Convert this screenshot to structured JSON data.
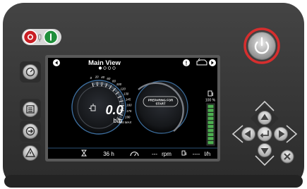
{
  "header": {
    "title": "Main View",
    "page_count": 4,
    "active_page": 0,
    "icons": [
      "left-arrow-icon",
      "info-icon",
      "engine-icon",
      "right-arrow-icon"
    ]
  },
  "pressure_gauge": {
    "value": "0.0",
    "unit": "bar",
    "scale_labels": [
      "0",
      "20",
      "40",
      "60",
      "80",
      "100",
      "120",
      "130",
      "145",
      "160",
      "175",
      "190",
      "205 MAX"
    ]
  },
  "status": {
    "message_line1": "PREPARING FOR",
    "message_line2": "START"
  },
  "fuel_level": {
    "label": "100 %",
    "level": 1.0,
    "segments": 10
  },
  "footer": {
    "hours": "36 h",
    "rpm_value": "---",
    "rpm_unit": "rpm",
    "fuel_rate_value": "----",
    "fuel_rate_unit": "l/h"
  },
  "left_buttons": [
    "tachometer-icon",
    "menu-icon",
    "enter-icon",
    "warning-icon"
  ],
  "colors": {
    "panel": "#3a3a3a",
    "lcd_bg": "#000000",
    "accent_blue": "#3d6e9e",
    "fuel_green": "#4caf50",
    "power_ring": "#d62e2e",
    "stop_red": "#c91f25",
    "start_green": "#1f8f3a"
  }
}
